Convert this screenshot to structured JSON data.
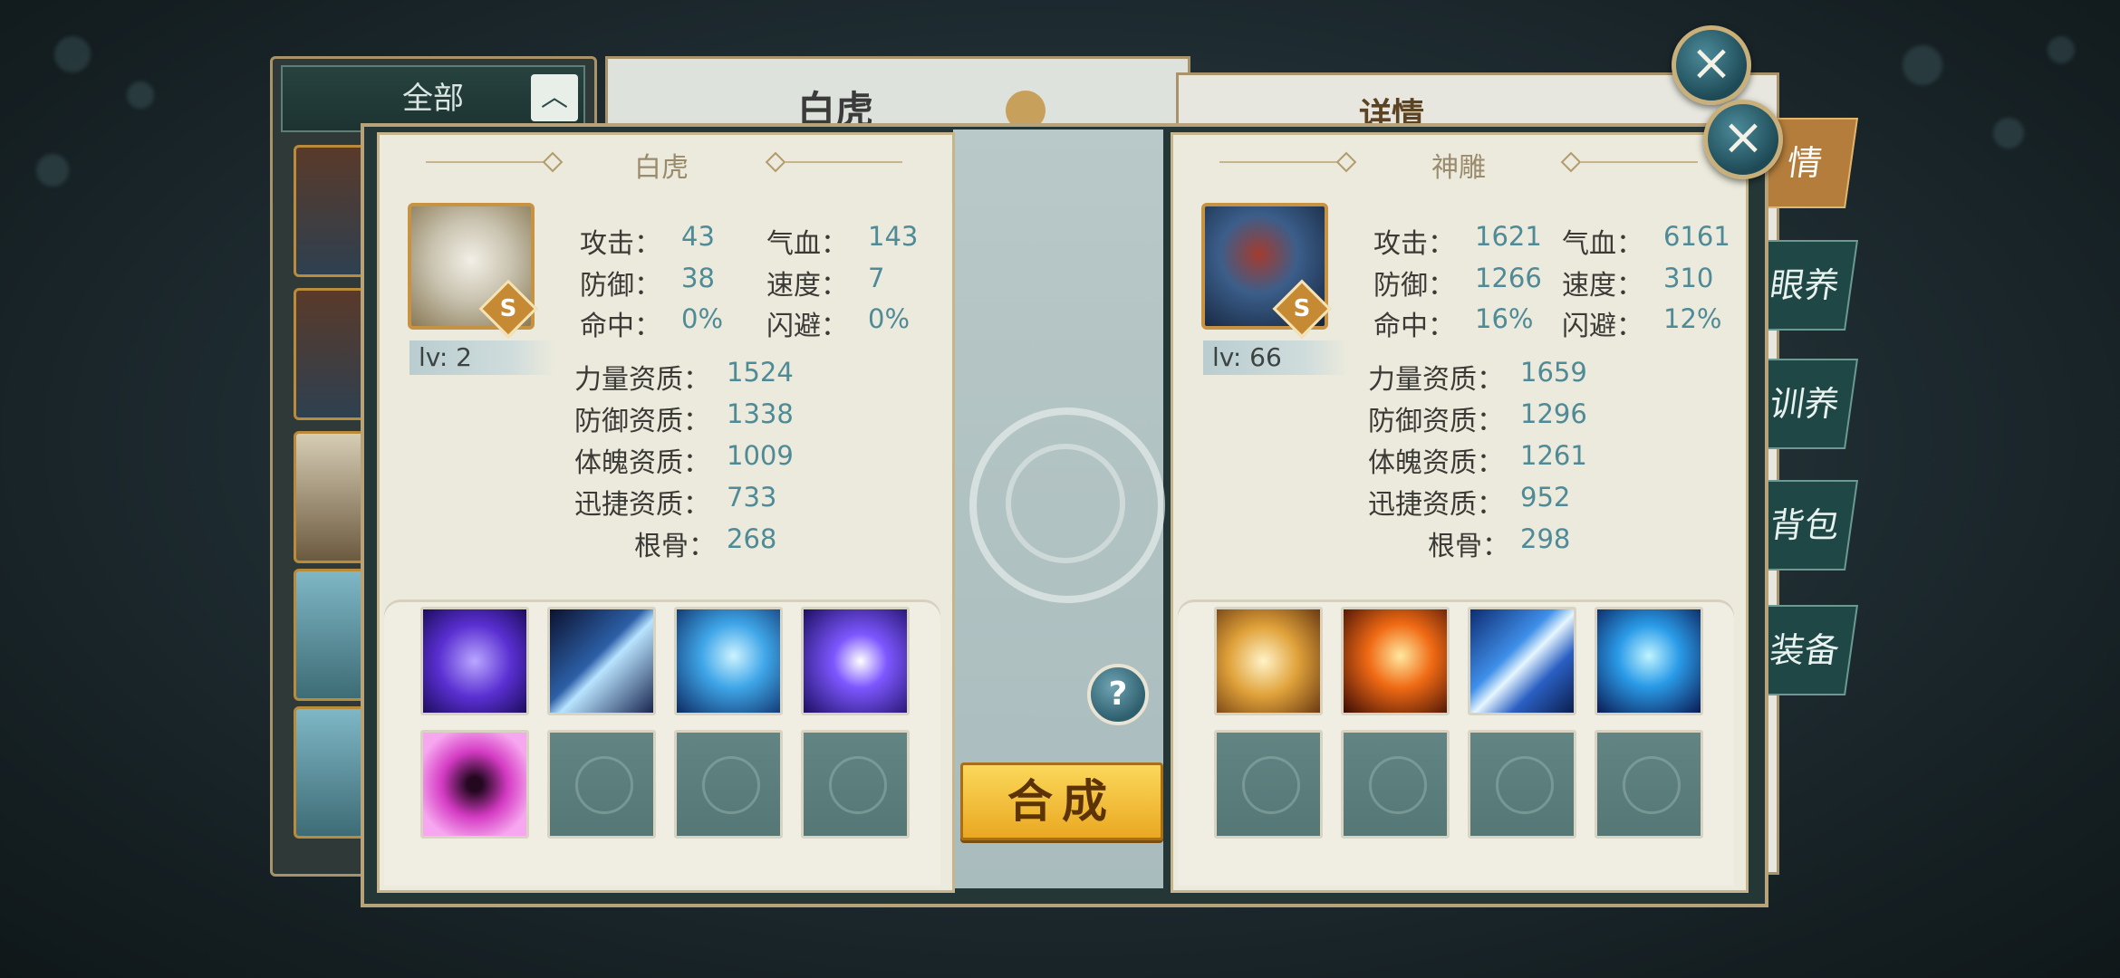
{
  "background": {
    "filter_label": "全部",
    "filter_toggle": "︿",
    "center_title": "白虎",
    "right_title": "详情",
    "tabs": [
      "情",
      "眼养",
      "训养",
      "背包",
      "装备"
    ]
  },
  "modal": {
    "close_icon": "×",
    "help_label": "?",
    "combine_label": "合成",
    "left_pet": {
      "name": "白虎",
      "grade": "S",
      "level": "lv: 2",
      "stats": [
        {
          "label": "攻击：",
          "value": "43"
        },
        {
          "label": "气血：",
          "value": "143"
        },
        {
          "label": "防御：",
          "value": "38"
        },
        {
          "label": "速度：",
          "value": "7"
        },
        {
          "label": "命中：",
          "value": "0%"
        },
        {
          "label": "闪避：",
          "value": "0%"
        }
      ],
      "aptitudes": [
        {
          "label": "力量资质：",
          "value": "1524"
        },
        {
          "label": "防御资质：",
          "value": "1338"
        },
        {
          "label": "体魄资质：",
          "value": "1009"
        },
        {
          "label": "迅捷资质：",
          "value": "733"
        },
        {
          "label": "根骨：",
          "value": "268"
        }
      ],
      "skills": [
        "purple-vortex-skill",
        "claw-slash-skill",
        "ice-rune-skill",
        "purple-shield-skill",
        "pink-vortex-skill",
        "empty",
        "empty",
        "empty"
      ]
    },
    "right_pet": {
      "name": "神雕",
      "grade": "S",
      "level": "lv: 66",
      "stats": [
        {
          "label": "攻击：",
          "value": "1621"
        },
        {
          "label": "气血：",
          "value": "6161"
        },
        {
          "label": "防御：",
          "value": "1266"
        },
        {
          "label": "速度：",
          "value": "310"
        },
        {
          "label": "命中：",
          "value": "16%"
        },
        {
          "label": "闪避：",
          "value": "12%"
        }
      ],
      "aptitudes": [
        {
          "label": "力量资质：",
          "value": "1659"
        },
        {
          "label": "防御资质：",
          "value": "1296"
        },
        {
          "label": "体魄资质：",
          "value": "1261"
        },
        {
          "label": "迅捷资质：",
          "value": "952"
        },
        {
          "label": "根骨：",
          "value": "298"
        }
      ],
      "skills": [
        "golden-lion-skill",
        "fire-phoenix-skill",
        "lightning-skill",
        "ice-beast-skill",
        "empty",
        "empty",
        "empty",
        "empty"
      ]
    }
  },
  "colors": {
    "stat_value": "#4f8a97",
    "frame_gold": "#b8a27a",
    "combine_button": "#f5c33a"
  }
}
